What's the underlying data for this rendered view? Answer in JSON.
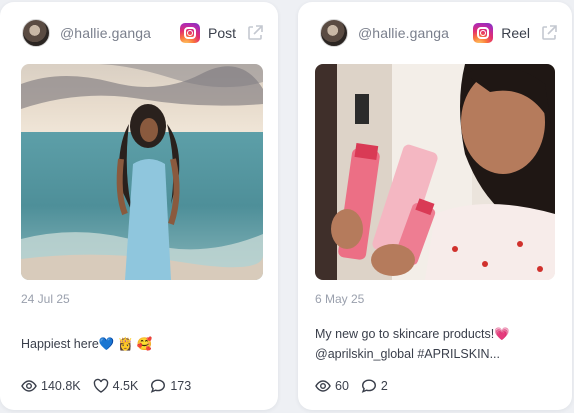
{
  "posts": [
    {
      "handle": "@hallie.ganga",
      "platform_icon": "instagram-icon",
      "type": "Post",
      "date": "24 Jul 25",
      "caption": "Happiest here💙 👸 🥰",
      "views": "140.8K",
      "likes": "4.5K",
      "comments": "173"
    },
    {
      "handle": "@hallie.ganga",
      "platform_icon": "instagram-icon",
      "type": "Reel",
      "date": "6 May 25",
      "caption_line1": "My new go to skincare products!💗",
      "caption_line2": "@aprilskin_global #APRILSKIN...",
      "views": "60",
      "comments": "2"
    }
  ],
  "colors": {
    "card_bg": "#ffffff",
    "page_bg": "#eef0f4",
    "muted_text": "#9aa0ad"
  }
}
